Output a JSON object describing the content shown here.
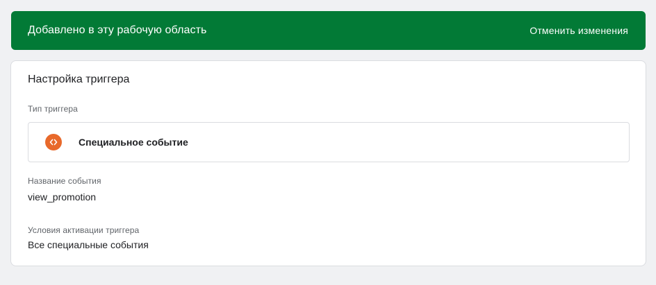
{
  "banner": {
    "message": "Добавлено в эту рабочую область",
    "action_label": "Отменить изменения",
    "color": "#027a36"
  },
  "card": {
    "title": "Настройка триггера",
    "trigger_type": {
      "label": "Тип триггера",
      "value": "Специальное событие",
      "icon": "code-brackets-icon",
      "icon_color": "#e8692b"
    },
    "event_name": {
      "label": "Название события",
      "value": "view_promotion"
    },
    "activation": {
      "label": "Условия активации триггера",
      "value": "Все специальные события"
    }
  }
}
